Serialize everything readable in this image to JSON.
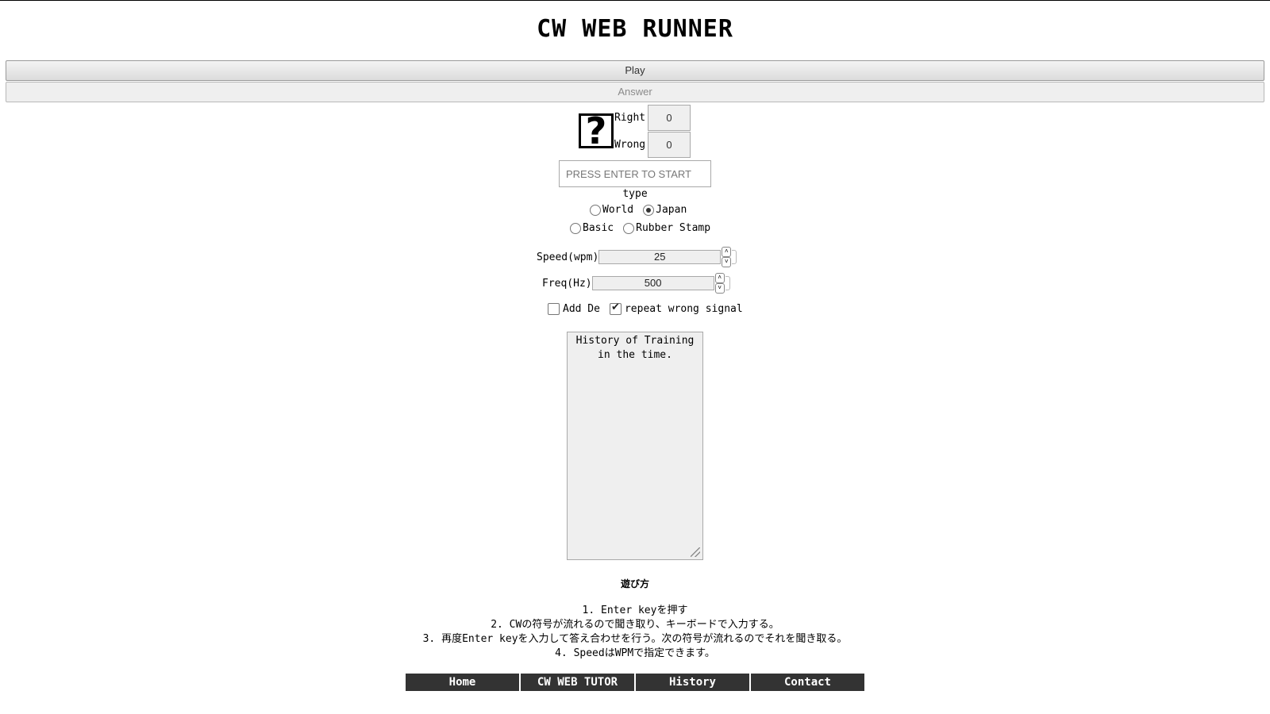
{
  "header": {
    "title": "CW WEB RUNNER"
  },
  "controls": {
    "play_label": "Play",
    "answer_label": "Answer"
  },
  "display": {
    "symbol": "?"
  },
  "score": {
    "right_label": "Right",
    "right_value": "0",
    "wrong_label": "Wrong",
    "wrong_value": "0"
  },
  "answer_input": {
    "placeholder": "PRESS ENTER TO START",
    "value": ""
  },
  "type": {
    "label": "type",
    "region_options": [
      {
        "label": "World",
        "checked": false
      },
      {
        "label": "Japan",
        "checked": true
      }
    ],
    "mode_options": [
      {
        "label": "Basic",
        "checked": false
      },
      {
        "label": "Rubber Stamp",
        "checked": false
      }
    ]
  },
  "speed": {
    "label": "Speed(wpm)",
    "value": "25"
  },
  "freq": {
    "label": "Freq(Hz)",
    "value": "500"
  },
  "options": {
    "add_de_label": "Add De",
    "add_de_checked": false,
    "repeat_label": "repeat wrong signal",
    "repeat_checked": true
  },
  "history": {
    "text": "History of Training in the time."
  },
  "howto": {
    "title": "遊び方",
    "steps": [
      "1. Enter keyを押す",
      "2. CWの符号が流れるので聞き取り、キーボードで入力する。",
      "3. 再度Enter keyを入力して答え合わせを行う。次の符号が流れるのでそれを聞き取る。",
      "4. SpeedはWPMで指定できます。"
    ]
  },
  "nav": [
    {
      "label": "Home"
    },
    {
      "label": "CW WEB TUTOR"
    },
    {
      "label": "History"
    },
    {
      "label": "Contact"
    }
  ]
}
